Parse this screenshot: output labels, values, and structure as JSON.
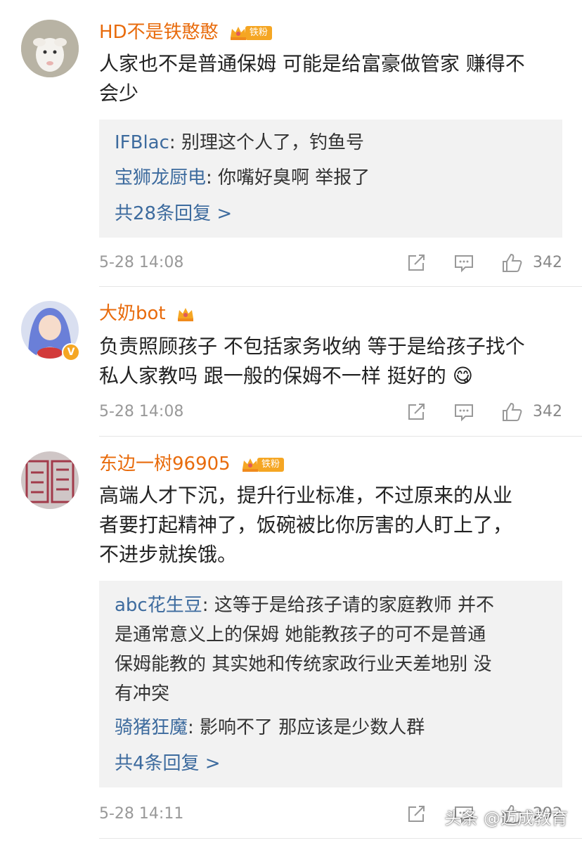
{
  "comments": [
    {
      "username": "HD不是铁憨憨",
      "fan_badge": "铁粉",
      "text_lines": [
        "人家也不是普通保姆 可能是给富豪做管家 赚得不",
        "会少"
      ],
      "replies": [
        {
          "user": "IFBlac",
          "text": "别理这个人了，钓鱼号"
        },
        {
          "user": "宝狮龙厨电",
          "text": "你嘴好臭啊 举报了"
        }
      ],
      "more_replies": "共28条回复 >",
      "time": "5-28 14:08",
      "likes": "342"
    },
    {
      "username": "大奶bot",
      "text_lines": [
        "负责照顾孩子 不包括家务收纳 等于是给孩子找个",
        "私人家教吗 跟一般的保姆不一样 挺好的"
      ],
      "emoji": "😋",
      "time": "5-28 14:08",
      "likes": "342"
    },
    {
      "username": "东边一树96905",
      "fan_badge": "铁粉",
      "text_lines": [
        "高端人才下沉，提升行业标准，不过原来的从业",
        "者要打起精神了，饭碗被比你厉害的人盯上了，",
        "不进步就挨饿。"
      ],
      "reply_lines": [
        {
          "user": "abc花生豆",
          "text": "这等于是给孩子请的家庭教师  并不"
        },
        {
          "text": "是通常意义上的保姆   她能教孩子的可不是普通"
        },
        {
          "text": "保姆能教的   其实她和传统家政行业天差地别  没"
        },
        {
          "text": "有冲突"
        },
        {
          "user": "骑猪狂魔",
          "text": "影响不了 那应该是少数人群"
        }
      ],
      "more_replies": "共4条回复 >",
      "time": "5-28 14:11",
      "likes": "292"
    }
  ],
  "watermark": "头条 @迈成教育",
  "colors": {
    "username": "#e86b0c",
    "reply_user": "#3d6b9e",
    "badge": "#f5a623"
  }
}
